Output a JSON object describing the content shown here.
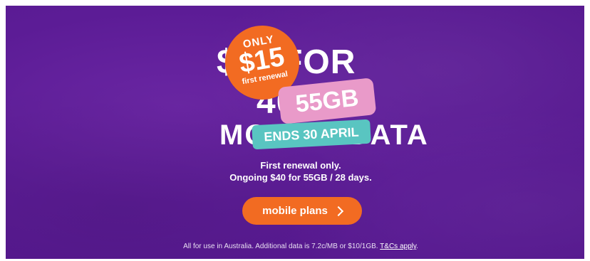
{
  "headline": {
    "line1_old": "$40",
    "line1_word": "FOR",
    "line2_old": "40GB",
    "line3": "MOBILE DATA"
  },
  "badge": {
    "only": "ONLY",
    "price": "$15",
    "subtitle": "first renewal"
  },
  "data_tag": "55GB",
  "ends_tag": "ENDS 30 APRIL",
  "info": {
    "line1": "First renewal only.",
    "line2": "Ongoing $40 for 55GB / 28 days."
  },
  "cta": {
    "label": "mobile plans"
  },
  "fine_print": {
    "text": "All for use in Australia. Additional data is 7.2c/MB or $10/1GB.",
    "link": "T&Cs apply",
    "period": "."
  },
  "colors": {
    "background": "#5c1c96",
    "orange": "#f26b22",
    "pink": "#e99ac9",
    "teal": "#59c5c1"
  }
}
